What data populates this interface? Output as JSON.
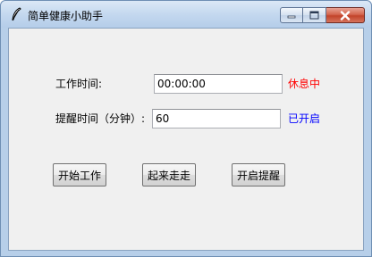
{
  "window": {
    "title": "简单健康小助手",
    "icon": "feather-icon"
  },
  "form": {
    "work_time_label": "工作时间:",
    "work_time_value": "00:00:00",
    "work_status": "休息中",
    "reminder_label": "提醒时间（分钟）:",
    "reminder_value": "60",
    "reminder_status": "已开启"
  },
  "buttons": {
    "start_work": "开始工作",
    "walk_around": "起来走走",
    "enable_reminder": "开启提醒"
  },
  "colors": {
    "work_status": "#ff0000",
    "reminder_status": "#0000ff"
  }
}
